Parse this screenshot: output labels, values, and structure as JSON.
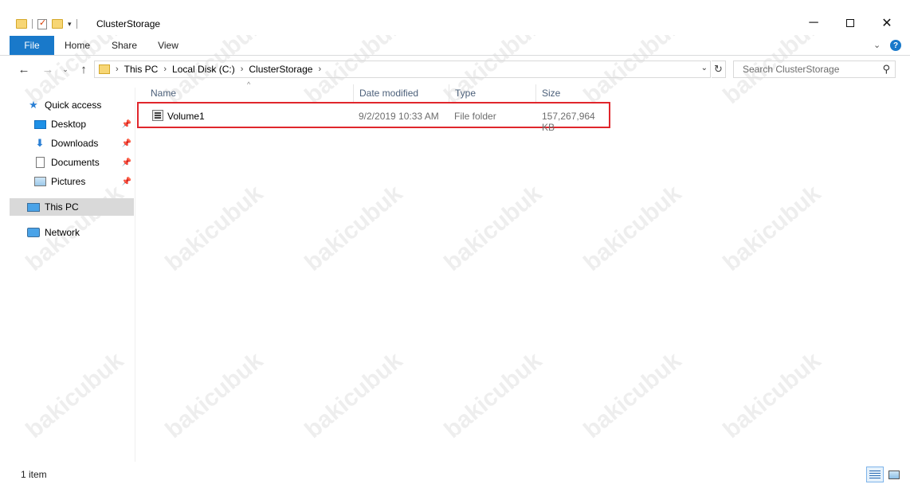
{
  "window": {
    "title": "ClusterStorage",
    "min_glyph": "─",
    "close_glyph": "✕"
  },
  "ribbon": {
    "tabs": [
      "File",
      "Home",
      "Share",
      "View"
    ],
    "expand_glyph": "⌄",
    "help_glyph": "?"
  },
  "address": {
    "back_glyph": "←",
    "forward_glyph": "→",
    "recent_glyph": "⌄",
    "up_glyph": "↑",
    "crumbs": [
      "This PC",
      "Local Disk (C:)",
      "ClusterStorage"
    ],
    "crumb_sep": "›",
    "dropdown_glyph": "⌄",
    "refresh_glyph": "↻"
  },
  "search": {
    "placeholder": "Search ClusterStorage",
    "icon_glyph": "⚲"
  },
  "navpane": {
    "quick_access": "Quick access",
    "desktop": "Desktop",
    "downloads": "Downloads",
    "documents": "Documents",
    "pictures": "Pictures",
    "this_pc": "This PC",
    "network": "Network",
    "pin_glyph": "📌",
    "star_glyph": "★",
    "download_glyph": "⬇"
  },
  "columns": {
    "name": "Name",
    "date_modified": "Date modified",
    "type": "Type",
    "size": "Size",
    "sort_glyph": "^"
  },
  "files": [
    {
      "name": "Volume1",
      "date_modified": "9/2/2019 10:33 AM",
      "type": "File folder",
      "size": "157,267,964 KB"
    }
  ],
  "status": {
    "item_count": "1 item"
  },
  "watermark": "bakicubuk",
  "colors": {
    "accent": "#1979ca",
    "highlight_border": "#e0262c",
    "selected_nav": "#d9d9d9"
  }
}
